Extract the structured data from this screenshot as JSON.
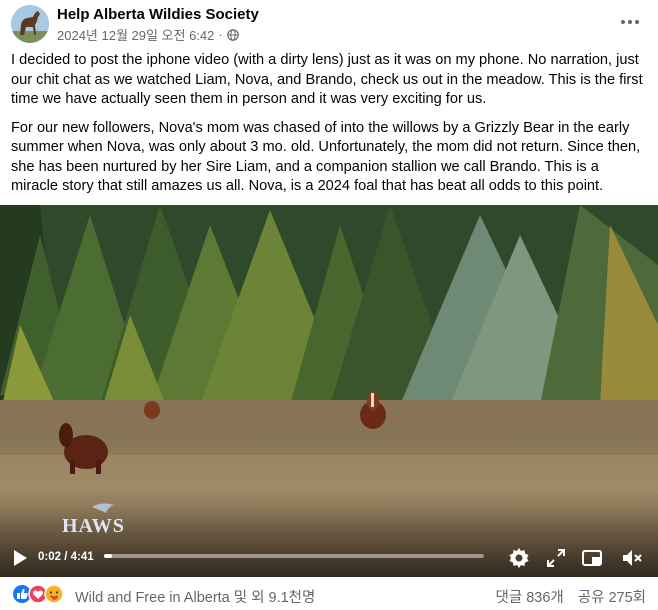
{
  "post": {
    "page_name": "Help Alberta Wildies Society",
    "date": "2024년 12월 29일 오전 6:42",
    "separator": "·",
    "paragraphs": [
      "I decided to post the iphone video (with a dirty lens) just as it was on my phone. No narration, just our chit chat as we watched Liam, Nova, and Brando, check us out in the meadow. This is the first time we have actually seen them in person and it was very exciting for us.",
      "For our new followers, Nova's mom was chased of into the willows by a Grizzly Bear in the early summer when Nova, was only about 3 mo. old. Unfortunately, the mom did not return. Since then, she has been nurtured by her Sire Liam, and a companion stallion we call Brando. This is a miracle story that still amazes us all. Nova, is a 2024 foal that has beat all odds to this point."
    ]
  },
  "video": {
    "watermark": "HAWS",
    "current_time": "0:02",
    "duration": "4:41",
    "time_display": "0:02 / 4:41",
    "progress": 0.007
  },
  "footer": {
    "reactions_text": "Wild and Free in Alberta 및 외 9.1천명",
    "comments": "댓글 836개",
    "shares": "공유 275회",
    "reaction_icons": [
      "like-icon",
      "love-icon",
      "care-icon"
    ]
  },
  "colors": {
    "text_primary": "#050505",
    "text_secondary": "#65676b",
    "like_blue": "#1877f2",
    "love_red": "#f33e58",
    "care_yellow": "#f7b125"
  }
}
